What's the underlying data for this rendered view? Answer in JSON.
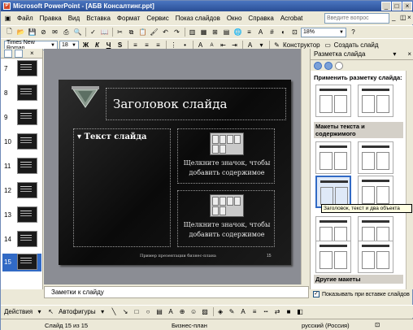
{
  "window": {
    "title": "Microsoft PowerPoint - [АБВ Консалтинг.ppt]"
  },
  "menu": {
    "items": [
      "Файл",
      "Правка",
      "Вид",
      "Вставка",
      "Формат",
      "Сервис",
      "Показ слайдов",
      "Окно",
      "Справка",
      "Acrobat"
    ],
    "help_placeholder": "Введите вопрос"
  },
  "standard_toolbar": {
    "zoom": "18%"
  },
  "format_toolbar": {
    "font": "Times New Roman",
    "size": "18",
    "bold": "Ж",
    "italic": "К",
    "underline": "Ч",
    "shadow": "S",
    "grow_font": "A",
    "shrink_font": "A",
    "designer_label": "Конструктор",
    "new_slide_label": "Создать слайд"
  },
  "thumbnails": [
    {
      "num": "7"
    },
    {
      "num": "8"
    },
    {
      "num": "9"
    },
    {
      "num": "10"
    },
    {
      "num": "11"
    },
    {
      "num": "12"
    },
    {
      "num": "13"
    },
    {
      "num": "14"
    },
    {
      "num": "15"
    }
  ],
  "slide": {
    "title": "Заголовок слайда",
    "text": "Текст слайда",
    "hint_top": "Щелкните значок, чтобы добавить содержимое",
    "hint_bottom": "Щелкните значок, чтобы добавить содержимое",
    "footer": "Пример презентации бизнес-плана",
    "page": "15"
  },
  "notes": {
    "placeholder": "Заметки к слайду"
  },
  "task_pane": {
    "title": "Разметка слайда",
    "apply_label": "Применить разметку слайда:",
    "section_text_content": "Макеты текста и содержимого",
    "section_other": "Другие макеты",
    "tooltip": "Заголовок, текст и два объекта",
    "show_on_insert": "Показывать при вставке слайдов"
  },
  "drawing_toolbar": {
    "actions": "Действия",
    "autoshapes": "Автофигуры"
  },
  "status": {
    "slide": "Слайд 15 из 15",
    "design": "Бизнес-план",
    "language": "русский (Россия)"
  }
}
